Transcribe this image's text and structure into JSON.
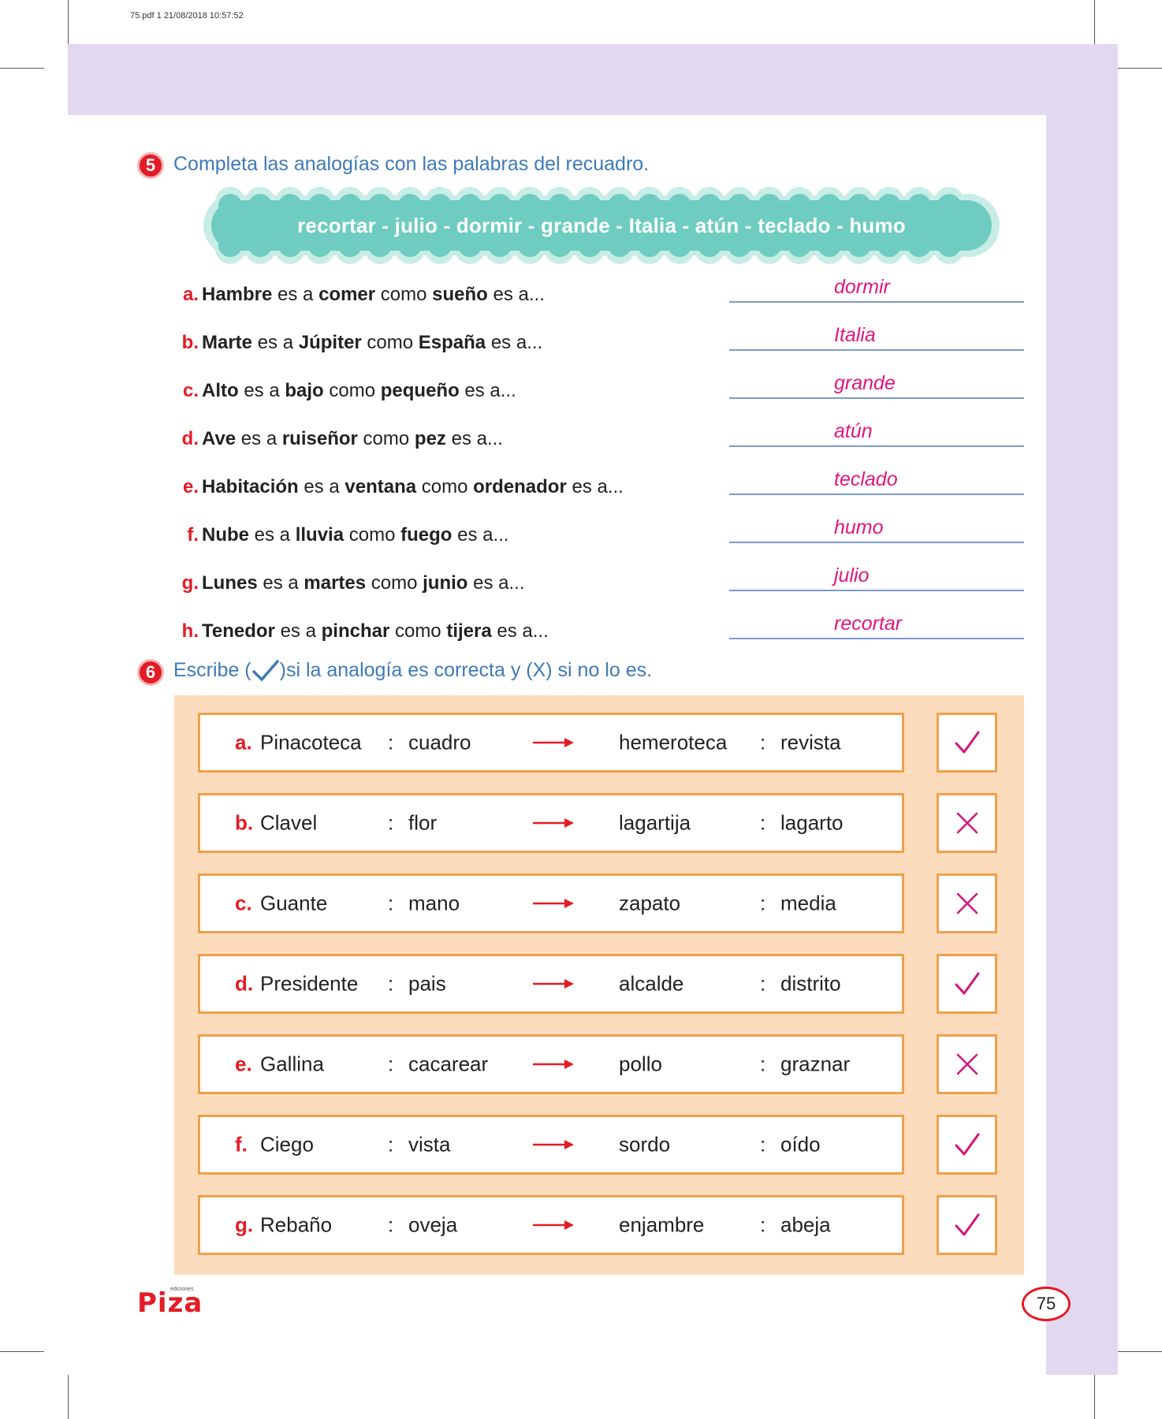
{
  "file_header": "75.pdf   1   21/08/2018   10:57:52",
  "exercise5": {
    "number": "5",
    "instruction": "Completa las analogías con las palabras del recuadro.",
    "word_bank": "recortar - julio - dormir - grande - Italia - atún - teclado - humo",
    "items": [
      {
        "letter": "a.",
        "w1": "Hambre",
        "t1": " es a ",
        "w2": "comer",
        "t2": " como ",
        "w3": "sueño",
        "t3": " es a...",
        "answer": "dormir"
      },
      {
        "letter": "b.",
        "w1": "Marte",
        "t1": " es a ",
        "w2": "Júpiter",
        "t2": " como ",
        "w3": "España",
        "t3": " es a...",
        "answer": "Italia"
      },
      {
        "letter": "c.",
        "w1": "Alto",
        "t1": " es a ",
        "w2": "bajo",
        "t2": " como ",
        "w3": "pequeño",
        "t3": " es a...",
        "answer": "grande"
      },
      {
        "letter": "d.",
        "w1": "Ave",
        "t1": " es a ",
        "w2": "ruiseñor",
        "t2": " como ",
        "w3": "pez",
        "t3": " es a...",
        "answer": "atún"
      },
      {
        "letter": "e.",
        "w1": "Habitación",
        "t1": " es a ",
        "w2": "ventana",
        "t2": " como ",
        "w3": "ordenador",
        "t3": " es a...",
        "answer": "teclado"
      },
      {
        "letter": "f.",
        "w1": "Nube",
        "t1": " es a ",
        "w2": "lluvia",
        "t2": " como ",
        "w3": "fuego",
        "t3": " es a...",
        "answer": "humo"
      },
      {
        "letter": "g.",
        "w1": "Lunes",
        "t1": " es a ",
        "w2": "martes",
        "t2": " como ",
        "w3": "junio",
        "t3": " es a...",
        "answer": "julio"
      },
      {
        "letter": "h.",
        "w1": "Tenedor",
        "t1": " es a ",
        "w2": "pinchar",
        "t2": " como ",
        "w3": "tijera",
        "t3": " es a...",
        "answer": "recortar"
      }
    ]
  },
  "exercise6": {
    "number": "6",
    "instruction_before": "Escribe (",
    "instruction_after": ")si la analogía es correcta y (X) si no lo es.",
    "rows": [
      {
        "letter": "a.",
        "a": "Pinacoteca",
        "sep1": ":",
        "b": "cuadro",
        "c": "hemeroteca",
        "sep2": ":",
        "d": "revista",
        "mark": "check"
      },
      {
        "letter": "b.",
        "a": "Clavel",
        "sep1": ":",
        "b": "flor",
        "c": "lagartija",
        "sep2": ":",
        "d": "lagarto",
        "mark": "cross"
      },
      {
        "letter": "c.",
        "a": "Guante",
        "sep1": ":",
        "b": "mano",
        "c": "zapato",
        "sep2": ":",
        "d": "media",
        "mark": "cross"
      },
      {
        "letter": "d.",
        "a": "Presidente",
        "sep1": ":",
        "b": "pais",
        "c": "alcalde",
        "sep2": ":",
        "d": "distrito",
        "mark": "check"
      },
      {
        "letter": "e.",
        "a": "Gallina",
        "sep1": ":",
        "b": "cacarear",
        "c": "pollo",
        "sep2": ":",
        "d": "graznar",
        "mark": "cross"
      },
      {
        "letter": "f.",
        "a": "Ciego",
        "sep1": ":",
        "b": "vista",
        "c": "sordo",
        "sep2": ":",
        "d": "oído",
        "mark": "check"
      },
      {
        "letter": "g.",
        "a": "Rebaño",
        "sep1": ":",
        "b": "oveja",
        "c": "enjambre",
        "sep2": ":",
        "d": "abeja",
        "mark": "check"
      }
    ]
  },
  "footer": {
    "logo_small": "ediciones",
    "logo_main": "Piza",
    "page_number": "75"
  },
  "colors": {
    "accent_red": "#e31c25",
    "title_blue": "#3f7ab8",
    "answer_pink": "#e3157f",
    "word_bank_teal": "#6ecdc0",
    "band_lavender": "#e2d9f0",
    "panel_peach": "#fddcbd",
    "box_orange": "#f0a04a",
    "mark_magenta": "#d4147a"
  }
}
